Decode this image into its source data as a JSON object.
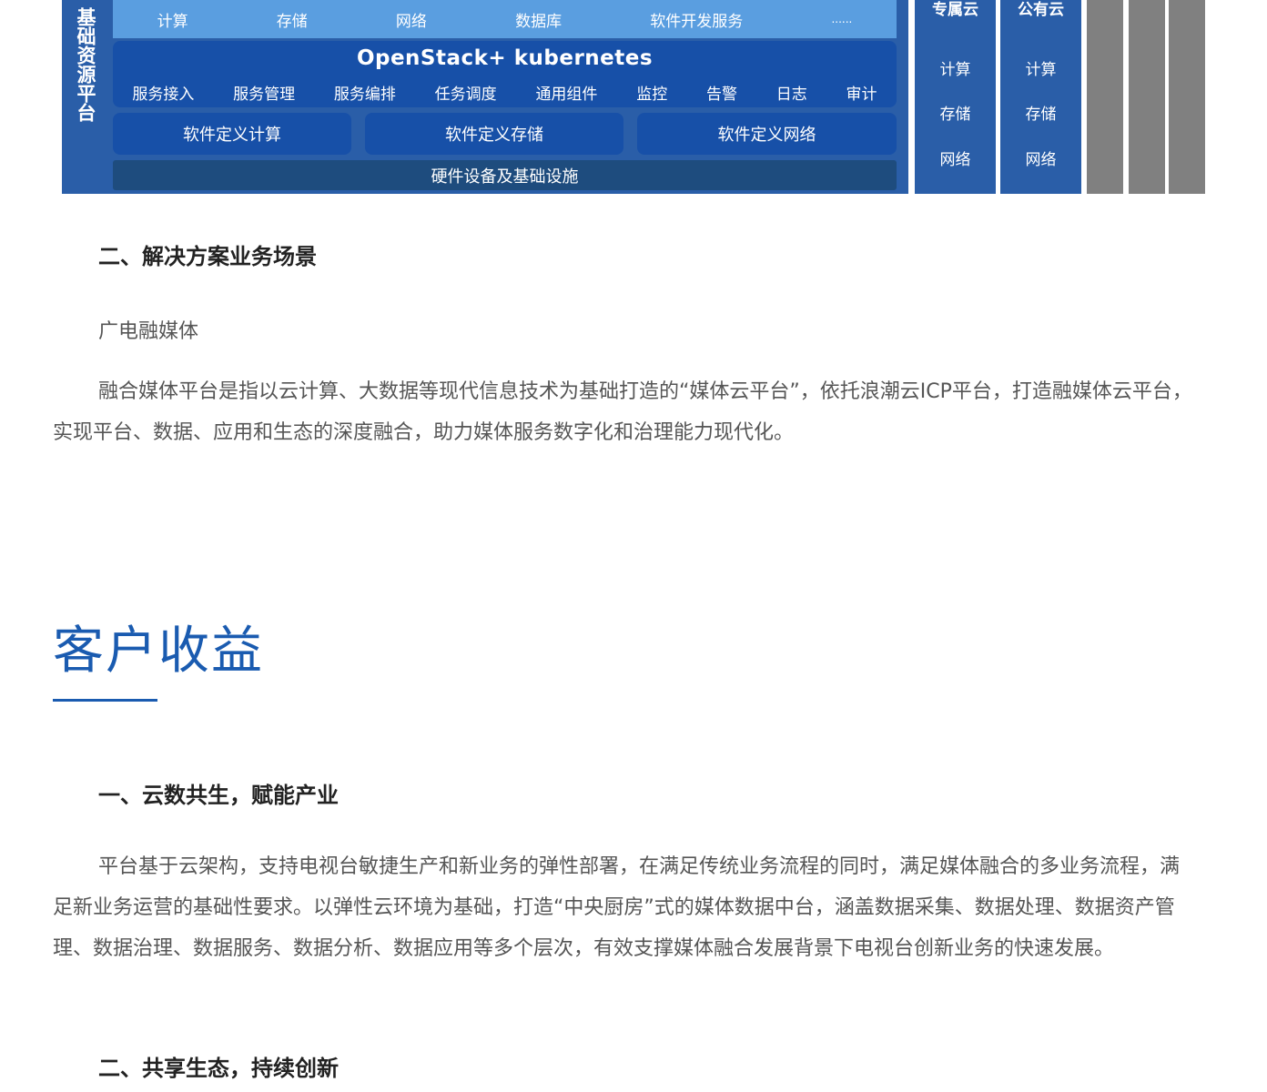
{
  "diagram": {
    "platform_label": "基础资源平台",
    "top_row": [
      "计算",
      "存储",
      "网络",
      "数据库",
      "软件开发服务",
      "......"
    ],
    "middle_title": "OpenStack+ kubernetes",
    "middle_items": [
      "服务接入",
      "服务管理",
      "服务编排",
      "任务调度",
      "通用组件",
      "监控",
      "告警",
      "日志",
      "审计"
    ],
    "sd_boxes": [
      "软件定义计算",
      "软件定义存储",
      "软件定义网络"
    ],
    "hardware": "硬件设备及基础设施",
    "clouds": [
      {
        "title": "专属云",
        "items": [
          "计算",
          "存储",
          "网络"
        ]
      },
      {
        "title": "公有云",
        "items": [
          "计算",
          "存储",
          "网络"
        ]
      }
    ],
    "colors": {
      "platform": "#2a5ea8",
      "top_row": "#5a9ee0",
      "box": "#1750a8",
      "hardware": "#1e4c7e",
      "gray": "#808080"
    }
  },
  "scenario": {
    "heading": "二、解决方案业务场景",
    "subheading": "广电融媒体",
    "paragraph": "融合媒体平台是指以云计算、大数据等现代信息技术为基础打造的“媒体云平台”，依托浪潮云ICP平台，打造融媒体云平台，实现平台、数据、应用和生态的深度融合，助力媒体服务数字化和治理能力现代化。"
  },
  "benefits": {
    "title": "客户收益",
    "accent_color": "#1a5bb0",
    "item1_heading": "一、云数共生，赋能产业",
    "item1_paragraph": "平台基于云架构，支持电视台敏捷生产和新业务的弹性部署，在满足传统业务流程的同时，满足媒体融合的多业务流程，满足新业务运营的基础性要求。以弹性云环境为基础，打造“中央厨房”式的媒体数据中台，涵盖数据采集、数据处理、数据资产管理、数据治理、数据服务、数据分析、数据应用等多个层次，有效支撑媒体融合发展背景下电视台创新业务的快速发展。",
    "item2_heading": "二、共享生态，持续创新"
  }
}
